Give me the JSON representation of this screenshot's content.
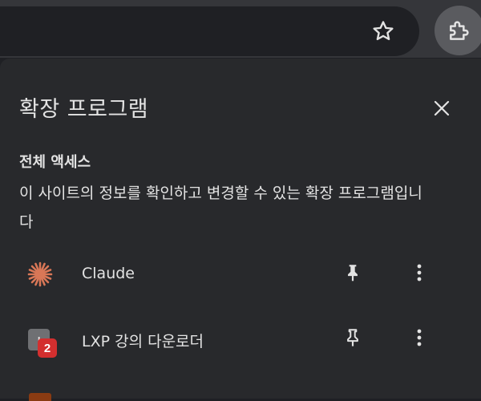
{
  "toolbar": {
    "bookmark_icon": "star-outline-icon",
    "extensions_icon": "puzzle-icon"
  },
  "popup": {
    "title": "확장 프로그램",
    "close_icon": "close-icon",
    "section_title": "전체 액세스",
    "section_description": "이 사이트의 정보를 확인하고 변경할 수 있는 확장 프로그램입니다"
  },
  "extensions": [
    {
      "name": "Claude",
      "icon": "claude-sunburst-icon",
      "icon_color": "#d97757",
      "pinned": true
    },
    {
      "name": "LXP 강의 다운로더",
      "icon": "lxp-icon",
      "icon_letter": "L",
      "badge": "2",
      "badge_color": "#d32f2f",
      "pinned": false
    }
  ],
  "colors": {
    "background": "#1f2024",
    "popup": "#28292c",
    "toolbar": "#35363a",
    "text": "#e3e3e3"
  }
}
